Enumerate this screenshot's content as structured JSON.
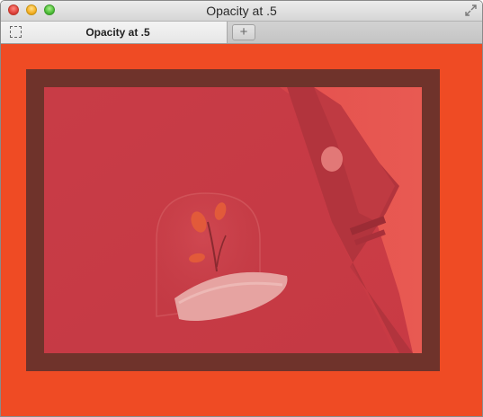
{
  "window": {
    "title": "Opacity at .5"
  },
  "tabs": [
    {
      "label": "Opacity at .5"
    }
  ],
  "toolbar": {
    "new_tab_label": "+"
  },
  "colors": {
    "page_background": "#ef4b24",
    "frame_border": "#6f332b",
    "image_tint": "#d94848"
  },
  "icons": {
    "close": "close-icon",
    "minimize": "minimize-icon",
    "zoom": "zoom-icon",
    "fullscreen": "fullscreen-icon",
    "tab": "dashed-page-icon",
    "new_tab": "plus-icon"
  }
}
